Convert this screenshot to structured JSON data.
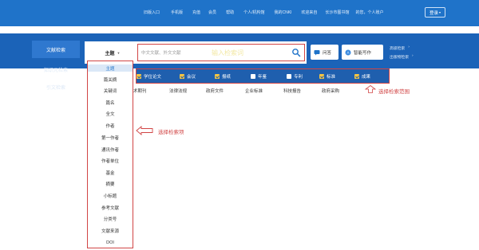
{
  "topbar": {
    "links": [
      "旧版入口",
      "手机版",
      "充值",
      "会员",
      "帮助",
      "个人/机构馆",
      "我的CNKI",
      "欢迎来自",
      "长沙市图书馆",
      "的您，个人账户"
    ],
    "login_label": "登录"
  },
  "left_tabs": [
    "文献检索",
    "知识元检索",
    "引文检索"
  ],
  "search": {
    "field_label": "主题",
    "placeholder": "中文文献、外文文献",
    "annotation": "输入检索词"
  },
  "actions": {
    "qa_label": "问答",
    "write_label": "智能写作"
  },
  "advanced": [
    "高级检索",
    "出版物检索"
  ],
  "types": [
    {
      "label": "学位论文",
      "checked": true
    },
    {
      "label": "会议",
      "checked": true
    },
    {
      "label": "报纸",
      "checked": true
    },
    {
      "label": "年鉴",
      "checked": false
    },
    {
      "label": "专利",
      "checked": false
    },
    {
      "label": "标准",
      "checked": true
    },
    {
      "label": "成果",
      "checked": true
    }
  ],
  "subnav": [
    "术期刊",
    "法律法规",
    "政府文件",
    "企业标准",
    "科技报告",
    "政府采购"
  ],
  "dropdown": {
    "items": [
      "主题",
      "篇关摘",
      "关键词",
      "篇名",
      "全文",
      "作者",
      "第一作者",
      "通讯作者",
      "作者单位",
      "基金",
      "摘要",
      "小标题",
      "参考文献",
      "分类号",
      "文献来源",
      "DOI"
    ],
    "selected_index": 0
  },
  "annotations": {
    "field": "选择检索项",
    "types": "选择检索范围"
  },
  "colors": {
    "topbar": "#1f73c9",
    "band": "#1b63b8",
    "annotation": "#d14545",
    "checked": "#f5c542"
  }
}
